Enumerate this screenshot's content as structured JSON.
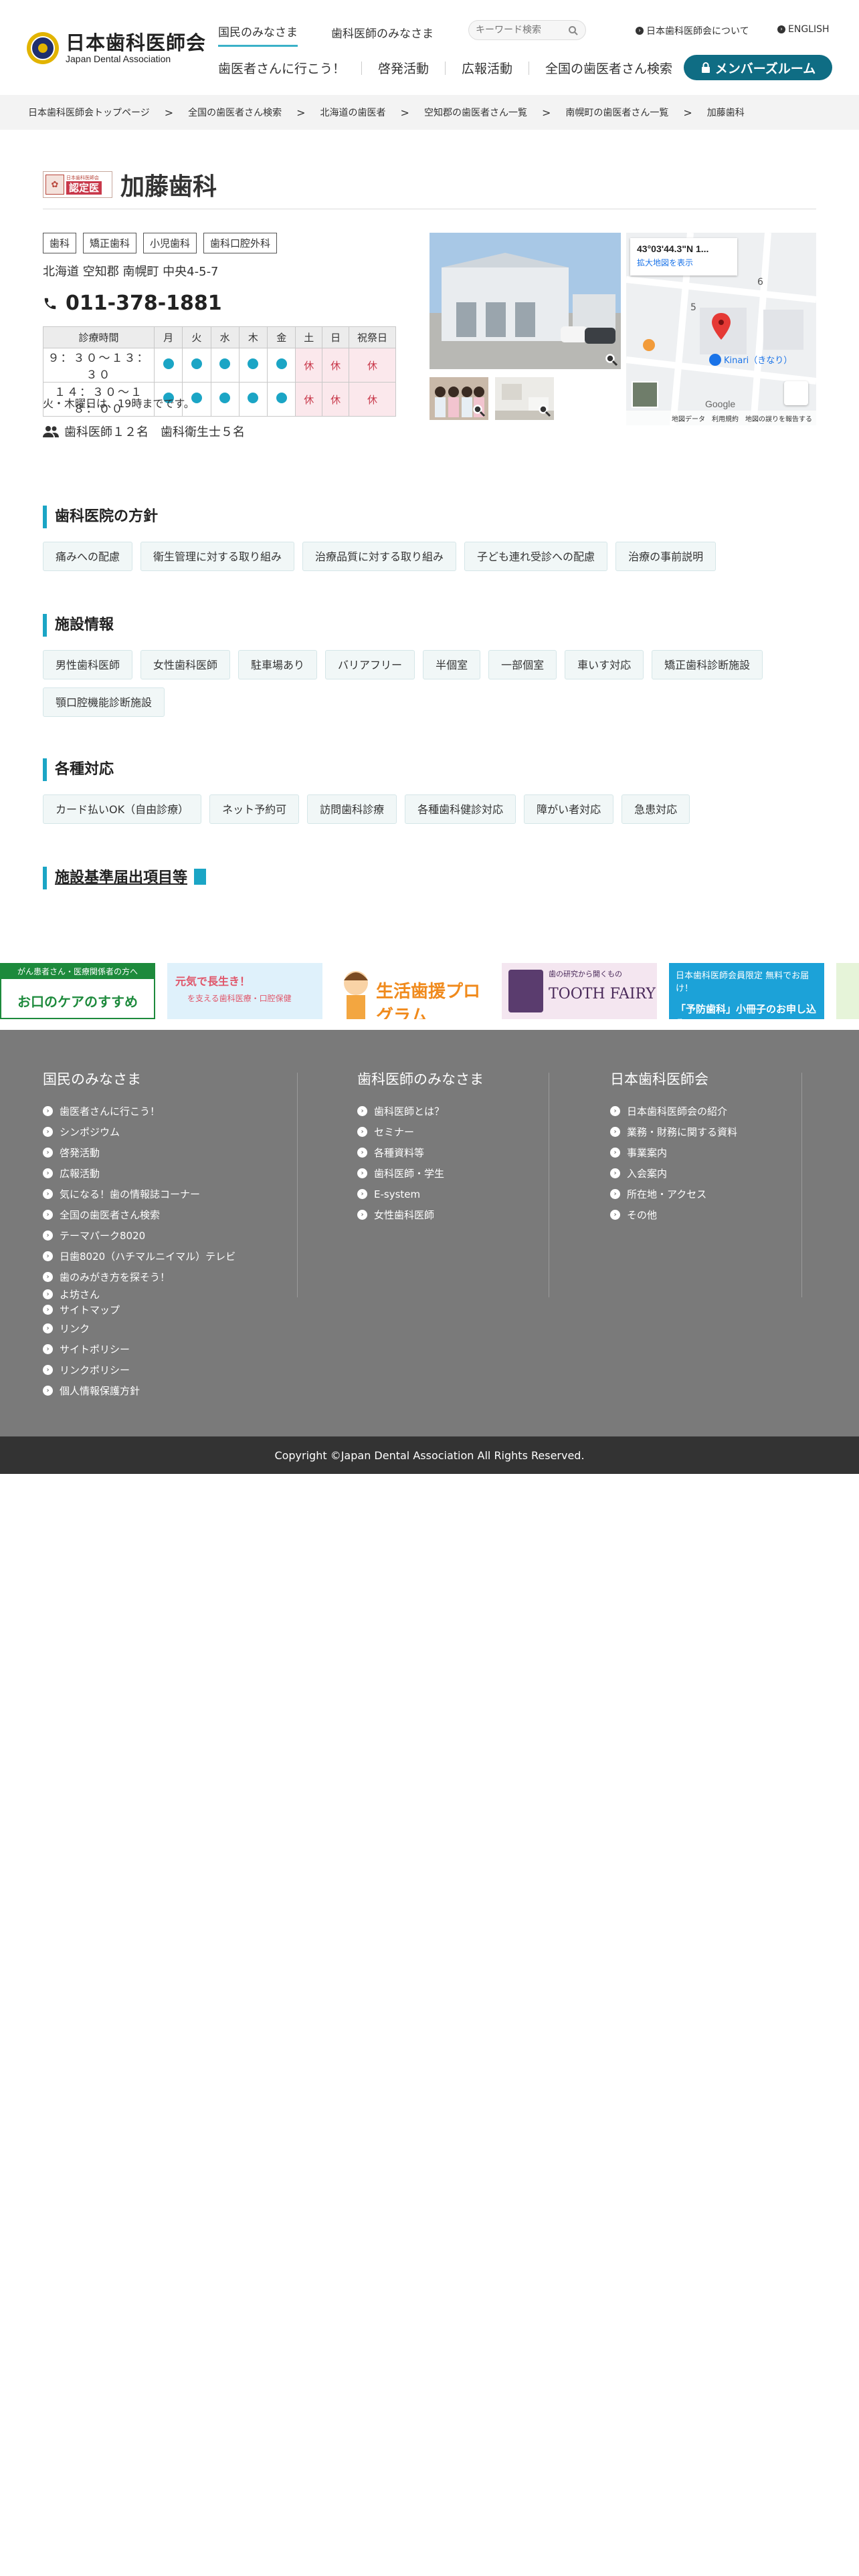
{
  "header": {
    "logo_jp": "日本歯科医師会",
    "logo_en": "Japan Dental Association",
    "tabs": [
      "国民のみなさま",
      "歯科医師のみなさま"
    ],
    "search_placeholder": "キーワード検索",
    "about": "日本歯科医師会について",
    "english": "ENGLISH",
    "main_nav": [
      "歯医者さんに行こう！",
      "啓発活動",
      "広報活動",
      "全国の歯医者さん検索"
    ],
    "member_button": "メンバーズルーム",
    "accent_color": "#0f6d84"
  },
  "breadcrumb": [
    "日本歯科医師会トップページ",
    "全国の歯医者さん検索",
    "北海道の歯医者",
    "空知郡の歯医者さん一覧",
    "南幌町の歯医者さん一覧",
    "加藤歯科"
  ],
  "clinic": {
    "badge_small": "日本歯科医師会",
    "badge_big": "認定医",
    "name": "加藤歯科",
    "tags": [
      "歯科",
      "矯正歯科",
      "小児歯科",
      "歯科口腔外科"
    ],
    "address": "北海道 空知郡 南幌町 中央4-5-7",
    "phone": "011-378-1881",
    "hours": {
      "header": [
        "診療時間",
        "月",
        "火",
        "水",
        "木",
        "金",
        "土",
        "日",
        "祝祭日"
      ],
      "rows": [
        {
          "time": "９：３０〜１３：３０",
          "days": [
            "open",
            "open",
            "open",
            "open",
            "open",
            "休",
            "休",
            "休"
          ]
        },
        {
          "time": "１４：３０〜１８：００",
          "days": [
            "open",
            "open",
            "open",
            "open",
            "open",
            "休",
            "休",
            "休"
          ]
        }
      ]
    },
    "hours_note": "火・木曜日は、19時までです。",
    "staff": "歯科医師１２名　歯科衛生士５名"
  },
  "map": {
    "coord": "43°03'44.3\"N 1...",
    "enlarge": "拡大地図を表示",
    "poi": "Kinari（きなり）",
    "google": "Google",
    "footer_items": [
      "地図データ",
      "利用規約",
      "地図の誤りを報告する"
    ],
    "block_numbers": [
      "5",
      "6"
    ]
  },
  "sections": {
    "policy": {
      "title": "歯科医院の方針",
      "items": [
        "痛みへの配慮",
        "衛生管理に対する取り組み",
        "治療品質に対する取り組み",
        "子ども連れ受診への配慮",
        "治療の事前説明"
      ]
    },
    "facility": {
      "title": "施設情報",
      "items": [
        "男性歯科医師",
        "女性歯科医師",
        "駐車場あり",
        "バリアフリー",
        "半個室",
        "一部個室",
        "車いす対応",
        "矯正歯科診断施設",
        "顎口腔機能診断施設"
      ]
    },
    "support": {
      "title": "各種対応",
      "items": [
        "カード払いOK（自由診療）",
        "ネット予約可",
        "訪問歯科診療",
        "各種歯科健診対応",
        "障がい者対応",
        "急患対応"
      ]
    },
    "standards": {
      "title": "施設基準届出項目等"
    }
  },
  "banners": [
    {
      "top": "がん患者さん・医療関係者の方へ",
      "main": "お口のケアのすすめ",
      "bg": "#ffffff",
      "color": "#1d8a3c"
    },
    {
      "top": "元気で長生き！",
      "main": "を支える歯科医療・口腔保健",
      "bg": "#dff1fb",
      "color": "#e0566a"
    },
    {
      "top": "",
      "main": "生活歯援プログラム",
      "bg": "#ffffff",
      "color": "#f08a1c"
    },
    {
      "top": "歯の研究から開くもの",
      "main": "TOOTH FAIRY",
      "bg": "#f4e6f0",
      "color": "#4a2a5a"
    },
    {
      "top": "日本歯科医師会員限定 無料でお届け！",
      "main": "「予防歯科」小冊子のお申し込み",
      "bg": "#1ca2d8",
      "color": "#ffffff"
    }
  ],
  "footer": {
    "col1": {
      "title": "国民のみなさま",
      "links": [
        "歯医者さんに行こう！",
        "シンポジウム",
        "啓発活動",
        "広報活動",
        "気になる！歯の情報誌コーナー",
        "全国の歯医者さん検索",
        "テーマパーク8020",
        "日歯8020（ハチマルニイマル）テレビ",
        "歯のみがき方を探そう！",
        "よ坊さん"
      ],
      "extra_links": [
        "サイトマップ",
        "リンク",
        "サイトポリシー",
        "リンクポリシー",
        "個人情報保護方針"
      ]
    },
    "col2": {
      "title": "歯科医師のみなさま",
      "links": [
        "歯科医師とは？",
        "セミナー",
        "各種資料等",
        "歯科医師・学生",
        "E-system",
        "女性歯科医師"
      ]
    },
    "col3": {
      "title": "日本歯科医師会",
      "links": [
        "日本歯科医師会の紹介",
        "業務・財務に関する資料",
        "事業案内",
        "入会案内",
        "所在地・アクセス",
        "その他"
      ]
    }
  },
  "copyright": "Copyright ©Japan Dental Association All Rights Reserved."
}
